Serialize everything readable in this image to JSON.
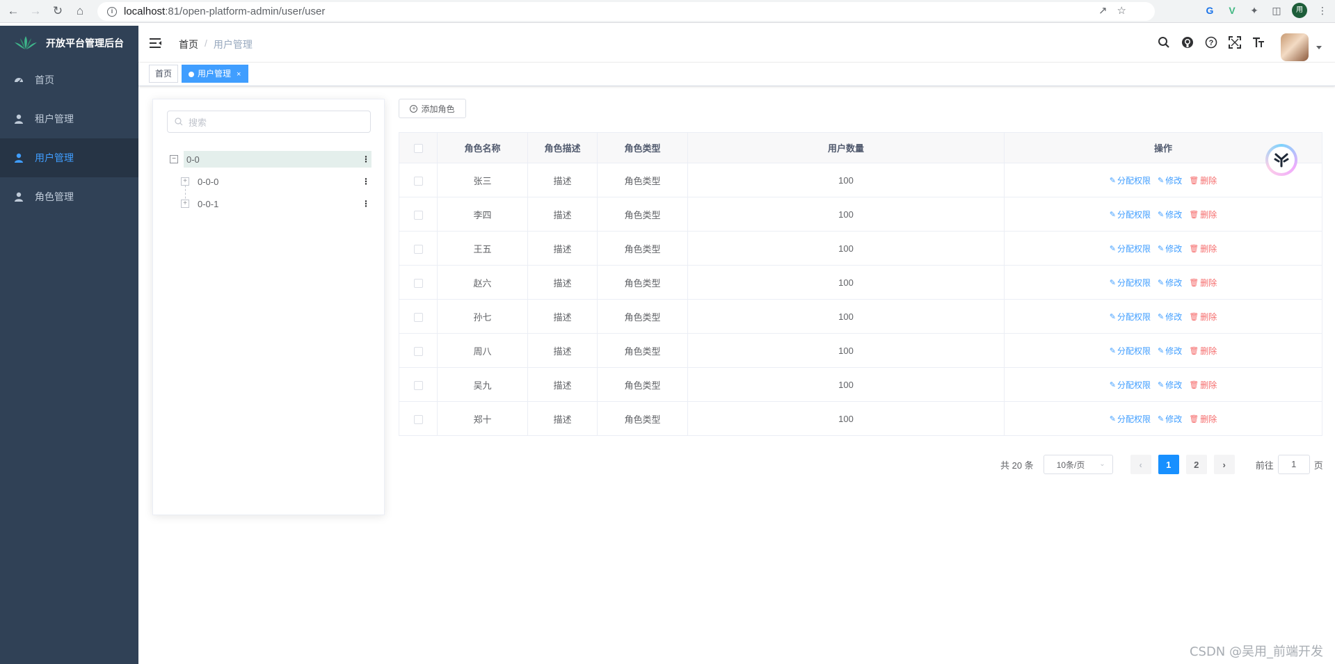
{
  "browser": {
    "url_host": "localhost",
    "url_path": ":81/open-platform-admin/user/user",
    "profile_initial": "用"
  },
  "sidebar": {
    "title": "开放平台管理后台",
    "items": [
      {
        "label": "首页",
        "icon": "dashboard-icon"
      },
      {
        "label": "租户管理",
        "icon": "user-icon"
      },
      {
        "label": "用户管理",
        "icon": "user-icon",
        "active": true
      },
      {
        "label": "角色管理",
        "icon": "user-icon"
      }
    ],
    "colors": {
      "bg": "#304156",
      "active_bg": "#263445",
      "active_text": "#409eff",
      "text": "#bfcbd9"
    }
  },
  "navbar": {
    "breadcrumb": {
      "home": "首页",
      "separator": "/",
      "current": "用户管理"
    }
  },
  "tags": {
    "home": "首页",
    "active": "用户管理",
    "close": "×"
  },
  "tree": {
    "search_placeholder": "搜索",
    "root": {
      "label": "0-0",
      "toggle": "−"
    },
    "children": [
      {
        "label": "0-0-0",
        "toggle": "+"
      },
      {
        "label": "0-0-1",
        "toggle": "+"
      }
    ],
    "more": "⋮"
  },
  "toolbar": {
    "add_label": "添加角色"
  },
  "table": {
    "headers": {
      "name": "角色名称",
      "desc": "角色描述",
      "type": "角色类型",
      "count": "用户数量",
      "ops": "操作"
    },
    "ops": {
      "assign": "分配权限",
      "edit": "修改",
      "delete": "删除"
    },
    "rows": [
      {
        "name": "张三",
        "desc": "描述",
        "type": "角色类型",
        "count": "100"
      },
      {
        "name": "李四",
        "desc": "描述",
        "type": "角色类型",
        "count": "100"
      },
      {
        "name": "王五",
        "desc": "描述",
        "type": "角色类型",
        "count": "100"
      },
      {
        "name": "赵六",
        "desc": "描述",
        "type": "角色类型",
        "count": "100"
      },
      {
        "name": "孙七",
        "desc": "描述",
        "type": "角色类型",
        "count": "100"
      },
      {
        "name": "周八",
        "desc": "描述",
        "type": "角色类型",
        "count": "100"
      },
      {
        "name": "吴九",
        "desc": "描述",
        "type": "角色类型",
        "count": "100"
      },
      {
        "name": "郑十",
        "desc": "描述",
        "type": "角色类型",
        "count": "100"
      }
    ]
  },
  "pagination": {
    "total": "共 20 条",
    "page_size": "10条/页",
    "pages": [
      "1",
      "2"
    ],
    "current": "1",
    "goto_prefix": "前往",
    "goto_value": "1",
    "goto_suffix": "页"
  },
  "watermark": "CSDN @吴用_前端开发"
}
